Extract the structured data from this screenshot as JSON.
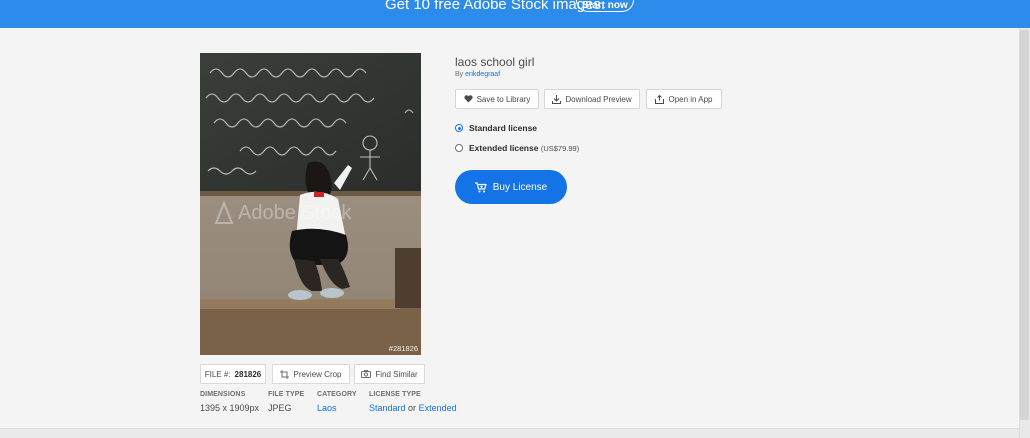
{
  "promo": {
    "text": "Get 10 free Adobe Stock images.",
    "button": "Start now"
  },
  "asset": {
    "title": "laos school girl",
    "by_prefix": "By",
    "author": "erikdegraaf",
    "image_id": "#281826",
    "watermark": "Adobe Stock"
  },
  "actions": {
    "save_to_library": "Save to Library",
    "download_preview": "Download Preview",
    "open_in_app": "Open in App"
  },
  "license": {
    "standard_label": "Standard license",
    "standard_selected": true,
    "extended_label": "Extended license",
    "extended_price": "(US$79.99)",
    "buy_button": "Buy License"
  },
  "image_tools": {
    "file_label": "FILE #:",
    "file_number": "281826",
    "preview_crop": "Preview Crop",
    "find_similar": "Find Similar"
  },
  "metadata": {
    "dimensions_label": "DIMENSIONS",
    "dimensions_value": "1395 x 1909px",
    "file_type_label": "FILE TYPE",
    "file_type_value": "JPEG",
    "category_label": "CATEGORY",
    "category_value": "Laos",
    "license_type_label": "LICENSE TYPE",
    "license_standard": "Standard",
    "license_or": "or",
    "license_extended": "Extended"
  },
  "colors": {
    "accent": "#1473e6",
    "promo_bg": "#2d8ceb",
    "page_bg": "#f4f4f4"
  }
}
